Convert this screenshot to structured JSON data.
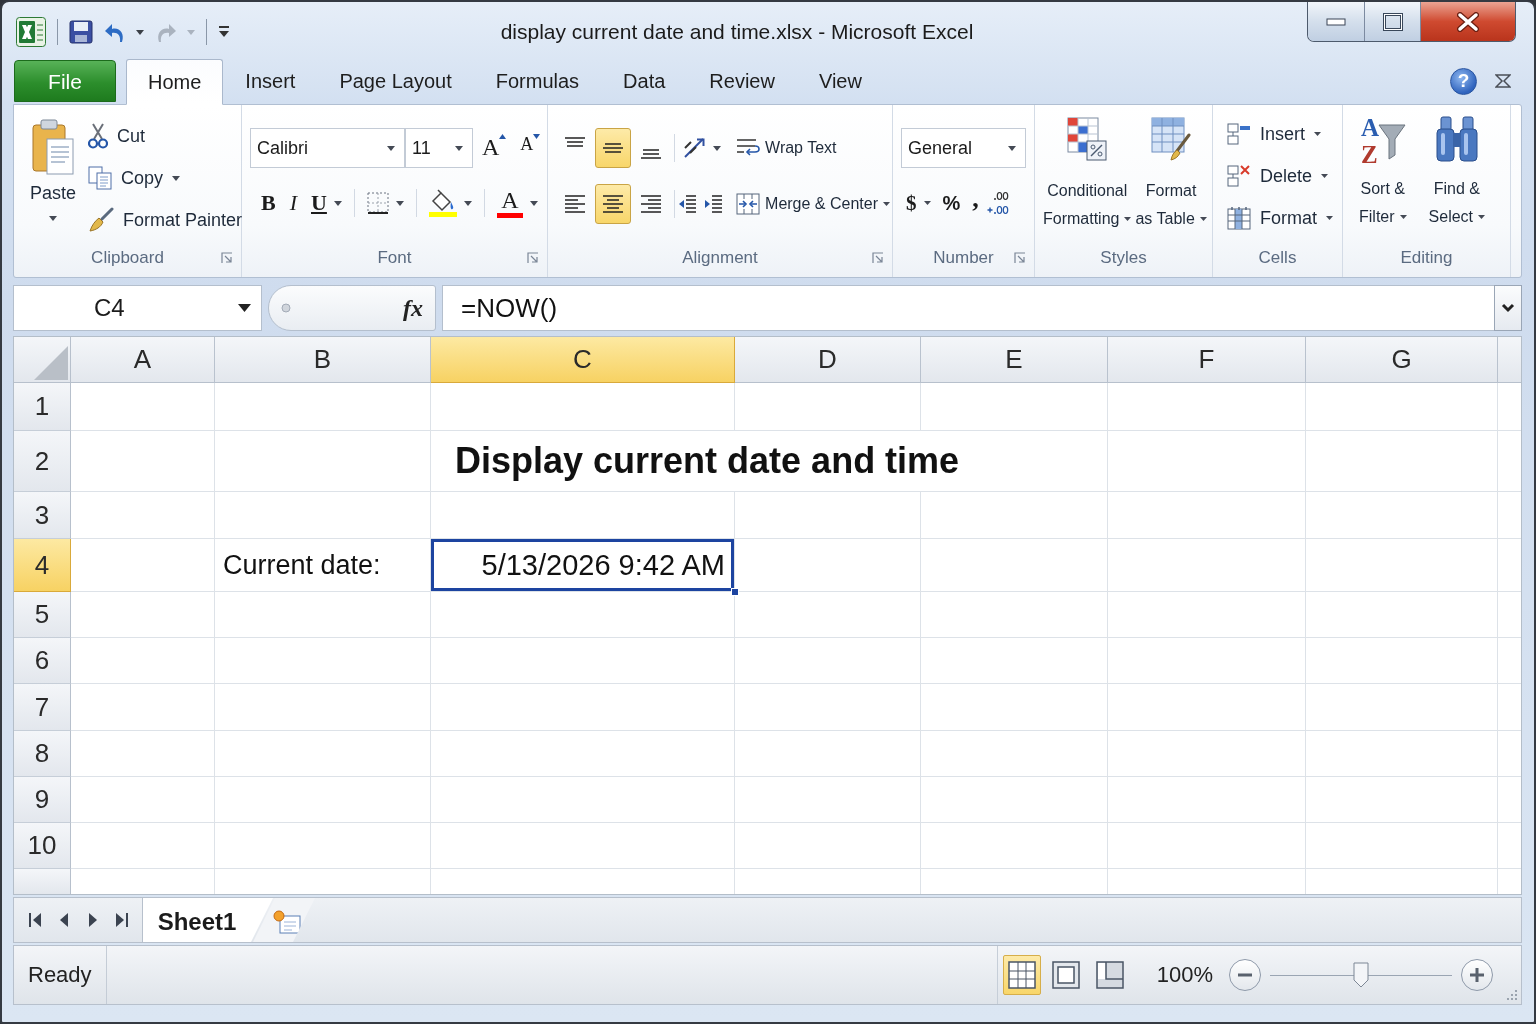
{
  "window": {
    "title": "display current date and time.xlsx - Microsoft Excel"
  },
  "quick_access": [
    {
      "kind": "save",
      "disabled": false,
      "dropdown": false
    },
    {
      "kind": "undo",
      "disabled": false,
      "dropdown": true
    },
    {
      "kind": "redo",
      "disabled": true,
      "dropdown": true
    },
    {
      "kind": "customize",
      "disabled": false,
      "dropdown": false
    }
  ],
  "ribbon_tabs": [
    {
      "label": "File",
      "kind": "backstage",
      "selected": false
    },
    {
      "label": "Home",
      "kind": "tab",
      "selected": true
    },
    {
      "label": "Insert",
      "kind": "tab",
      "selected": false
    },
    {
      "label": "Page Layout",
      "kind": "tab",
      "selected": false
    },
    {
      "label": "Formulas",
      "kind": "tab",
      "selected": false
    },
    {
      "label": "Data",
      "kind": "tab",
      "selected": false
    },
    {
      "label": "Review",
      "kind": "tab",
      "selected": false
    },
    {
      "label": "View",
      "kind": "tab",
      "selected": false
    }
  ],
  "help": {
    "glyph": "?"
  },
  "ribbon": {
    "clipboard": {
      "label": "Clipboard",
      "launcher": true,
      "paste": {
        "label": "Paste",
        "dropdown": true
      },
      "commands": [
        {
          "kind": "cut",
          "label": "Cut",
          "dropdown": false
        },
        {
          "kind": "copy",
          "label": "Copy",
          "dropdown": true
        },
        {
          "kind": "painter",
          "label": "Format Painter",
          "dropdown": false
        }
      ]
    },
    "font": {
      "label": "Font",
      "launcher": true,
      "font_name": "Calibri",
      "font_size": "11",
      "size_buttons": [
        {
          "kind": "grow",
          "glyph": "A"
        },
        {
          "kind": "shrink",
          "glyph": "A"
        }
      ],
      "styles": [
        {
          "kind": "bold",
          "glyph": "B",
          "dropdown": false
        },
        {
          "kind": "italic",
          "glyph": "I",
          "dropdown": false
        },
        {
          "kind": "underline",
          "glyph": "U",
          "dropdown": true
        }
      ],
      "colors": [
        {
          "kind": "borders",
          "dropdown": true
        },
        {
          "kind": "fill",
          "dropdown": true
        },
        {
          "kind": "font",
          "glyph": "A",
          "dropdown": true
        }
      ]
    },
    "alignment": {
      "label": "Alignment",
      "launcher": true,
      "vertical": [
        {
          "kind": "top",
          "selected": false
        },
        {
          "kind": "middle",
          "selected": true
        },
        {
          "kind": "bottom",
          "selected": false
        }
      ],
      "horizontal": [
        {
          "kind": "left",
          "selected": false
        },
        {
          "kind": "center",
          "selected": true
        },
        {
          "kind": "right",
          "selected": false
        }
      ],
      "commands": [
        {
          "kind": "wrap",
          "label": "Wrap Text",
          "dropdown": false
        },
        {
          "kind": "merge",
          "label": "Merge & Center",
          "dropdown": true
        }
      ]
    },
    "number": {
      "label": "Number",
      "launcher": true,
      "format": "General",
      "symbols": [
        {
          "kind": "currency",
          "glyph": "$",
          "dropdown": true
        },
        {
          "kind": "percent",
          "glyph": "%",
          "dropdown": false
        },
        {
          "kind": "comma",
          "glyph": ",",
          "dropdown": false
        }
      ]
    },
    "styles": {
      "label": "Styles",
      "launcher": false,
      "commands": [
        {
          "kind": "conditional",
          "lines": [
            "Conditional",
            "Formatting"
          ],
          "dropdown": true
        },
        {
          "kind": "table",
          "lines": [
            "Format",
            "as Table"
          ],
          "dropdown": true
        }
      ]
    },
    "cells": {
      "label": "Cells",
      "launcher": false,
      "commands": [
        {
          "kind": "insert",
          "label": "Insert",
          "dropdown": true
        },
        {
          "kind": "delete",
          "label": "Delete",
          "dropdown": true
        },
        {
          "kind": "format",
          "label": "Format",
          "dropdown": true
        }
      ]
    },
    "editing": {
      "label": "Editing",
      "launcher": false,
      "commands": [
        {
          "kind": "sort",
          "lines": [
            "Sort &",
            "Filter"
          ],
          "glyphs": [
            "A",
            "Z"
          ],
          "dropdown": true
        },
        {
          "kind": "find",
          "lines": [
            "Find &",
            "Select"
          ],
          "dropdown": true
        }
      ]
    }
  },
  "formula_bar": {
    "name_box": "C4",
    "function_label": "fx",
    "formula": "=NOW()"
  },
  "sheet": {
    "columns": [
      {
        "label": "A",
        "selected": false
      },
      {
        "label": "B",
        "selected": false
      },
      {
        "label": "C",
        "selected": true
      },
      {
        "label": "D",
        "selected": false
      },
      {
        "label": "E",
        "selected": false
      },
      {
        "label": "F",
        "selected": false
      },
      {
        "label": "G",
        "selected": false
      }
    ],
    "rows": [
      {
        "label": "1",
        "selected": false
      },
      {
        "label": "2",
        "selected": false,
        "cells": {
          "C": {
            "kind": "title",
            "text": "Display current date and time",
            "selected": false
          }
        }
      },
      {
        "label": "3",
        "selected": false
      },
      {
        "label": "4",
        "selected": true,
        "cells": {
          "B": {
            "kind": "label",
            "text": "Current date:",
            "selected": false
          },
          "C": {
            "kind": "value",
            "text": "5/13/2026 9:42 AM",
            "selected": true
          }
        }
      },
      {
        "label": "5",
        "selected": false
      },
      {
        "label": "6",
        "selected": false
      },
      {
        "label": "7",
        "selected": false
      },
      {
        "label": "8",
        "selected": false
      },
      {
        "label": "9",
        "selected": false
      },
      {
        "label": "10",
        "selected": false
      }
    ]
  },
  "sheet_tabs": [
    {
      "label": "Sheet1",
      "selected": true
    }
  ],
  "status_bar": {
    "status": "Ready",
    "views": [
      {
        "kind": "normal",
        "selected": true
      },
      {
        "kind": "page_layout",
        "selected": false
      },
      {
        "kind": "page_break",
        "selected": false
      }
    ],
    "zoom": "100%",
    "zoom_slider": {
      "level": 0.5
    }
  }
}
